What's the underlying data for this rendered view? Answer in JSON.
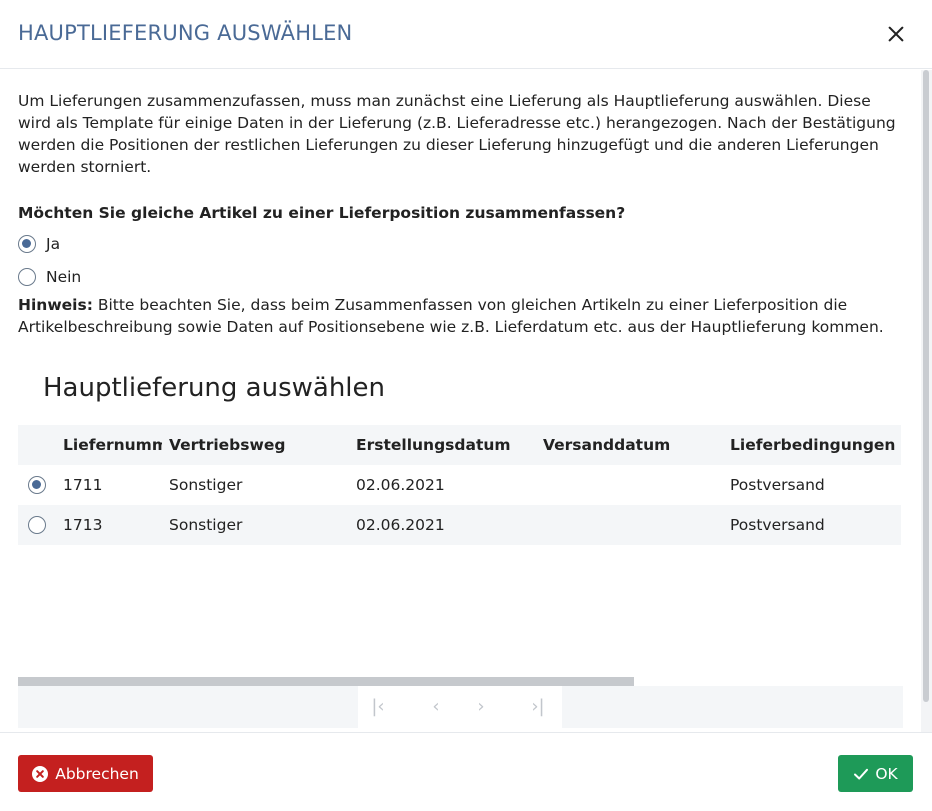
{
  "dialog": {
    "title": "HAUPTLIEFERUNG AUSWÄHLEN",
    "close_icon": "close-icon"
  },
  "intro": "Um Lieferungen zusammenzufassen, muss man zunächst eine Lieferung als Hauptlieferung auswählen. Diese wird als Template für einige Daten in der Lieferung (z.B. Lieferadresse etc.) herangezogen. Nach der Bestätigung werden die Positionen der restlichen Lieferungen zu dieser Lieferung hinzugefügt und die anderen Lieferungen werden storniert.",
  "question": "Möchten Sie gleiche Artikel zu einer Lieferposition zusammenfassen?",
  "options": [
    {
      "label": "Ja",
      "selected": true
    },
    {
      "label": "Nein",
      "selected": false
    }
  ],
  "hint": {
    "label": "Hinweis:",
    "text": " Bitte beachten Sie, dass beim Zusammenfassen von gleichen Artikeln zu einer Lieferposition die Artikelbeschreibung sowie Daten auf Positionsebene wie z.B. Lieferdatum etc. aus der Hauptlieferung kommen."
  },
  "section_title": "Hauptlieferung auswählen",
  "table": {
    "columns": [
      "Liefernumm",
      "Vertriebsweg",
      "Erstellungsdatum",
      "Versanddatum",
      "Lieferbedingungen"
    ],
    "rows": [
      {
        "selected": true,
        "nr": "1711",
        "weg": "Sonstiger",
        "erstellt": "02.06.2021",
        "versand": "",
        "bedingung": "Postversand"
      },
      {
        "selected": false,
        "nr": "1713",
        "weg": "Sonstiger",
        "erstellt": "02.06.2021",
        "versand": "",
        "bedingung": "Postversand"
      }
    ]
  },
  "pager": {
    "first": "|‹",
    "prev": "‹",
    "next": "›",
    "last": "›|"
  },
  "footer": {
    "cancel_label": "Abbrechen",
    "ok_label": "OK"
  },
  "colors": {
    "title": "#4a6a96",
    "cancel": "#c4201f",
    "ok": "#1e9a58"
  }
}
